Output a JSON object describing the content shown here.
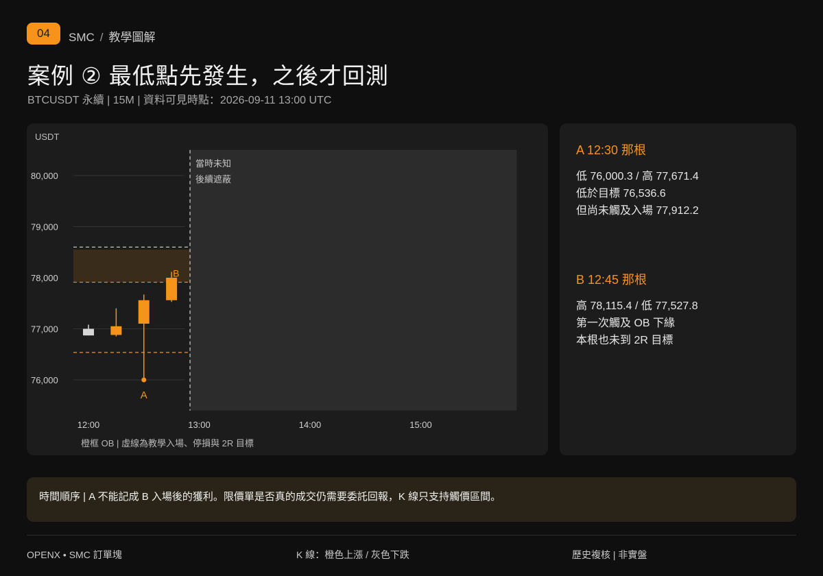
{
  "header": {
    "badge": "04",
    "crumb_section": "SMC",
    "crumb_sep": "/",
    "crumb_page": "教學圖解",
    "title": "案例 ② 最低點先發生，之後才回測",
    "subtitle": "BTCUSDT 永續 | 15M | 資料可見時點：2026-09-11 13:00 UTC"
  },
  "chart_data": {
    "type": "candlestick",
    "ylabel": "USDT",
    "ylim": [
      75400,
      80500
    ],
    "xlim": [
      "11:45",
      "15:52"
    ],
    "y_ticks": [
      "76,000",
      "77,000",
      "78,000",
      "79,000",
      "80,000"
    ],
    "y_tick_values": [
      76000,
      77000,
      78000,
      79000,
      80000
    ],
    "x_ticks": [
      "12:00",
      "13:00",
      "14:00",
      "15:00"
    ],
    "x_tick_values": [
      "12:00",
      "13:00",
      "14:00",
      "15:00"
    ],
    "candles": [
      {
        "time": "12:00",
        "open": 76870,
        "high": 77080,
        "low": 76870,
        "close": 77000,
        "color": "gray"
      },
      {
        "time": "12:15",
        "open": 77050,
        "high": 77400,
        "low": 76850,
        "close": 76880,
        "color": "orange"
      },
      {
        "time": "12:30",
        "open": 77100,
        "high": 77671.4,
        "low": 76000.3,
        "close": 77560,
        "color": "orange",
        "label": "A"
      },
      {
        "time": "12:45",
        "open": 77560,
        "high": 78115.4,
        "low": 77527.8,
        "close": 78000,
        "color": "orange",
        "label": "B"
      }
    ],
    "ob_zone": {
      "low": 77912.2,
      "high": 78550
    },
    "levels": {
      "stop": 78600,
      "entry": 77912.2,
      "target_2r": 76536.6
    },
    "visibility_cutoff": "12:55",
    "mask_end": "15:52",
    "mask_text": [
      "當時未知",
      "後續遮蔽"
    ],
    "caption": "橙框 OB | 虛線為教學入場、停損與 2R 目標",
    "colors": {
      "up": "#f7931a",
      "down": "#d6d6d6",
      "ob_fill": "#3a2c1a",
      "mask": "#2c2c2c",
      "grid": "#333333"
    }
  },
  "side": {
    "a_head": "A 12:30 那根",
    "a_lines": [
      "低 76,000.3 / 高 77,671.4",
      "低於目標 76,536.6",
      "但尚未觸及入場 77,912.2"
    ],
    "b_head": "B 12:45 那根",
    "b_lines": [
      "高 78,115.4 / 低 77,527.8",
      "第一次觸及 OB 下緣",
      "本根也未到 2R 目標"
    ]
  },
  "note": "時間順序 | A 不能記成 B 入場後的獲利。限價單是否真的成交仍需要委託回報，K 線只支持觸價區間。",
  "footer": {
    "left": "OPENX • SMC 訂單塊",
    "center": "K 線：橙色上漲 / 灰色下跌",
    "right": "歷史複核 | 非實盤"
  }
}
